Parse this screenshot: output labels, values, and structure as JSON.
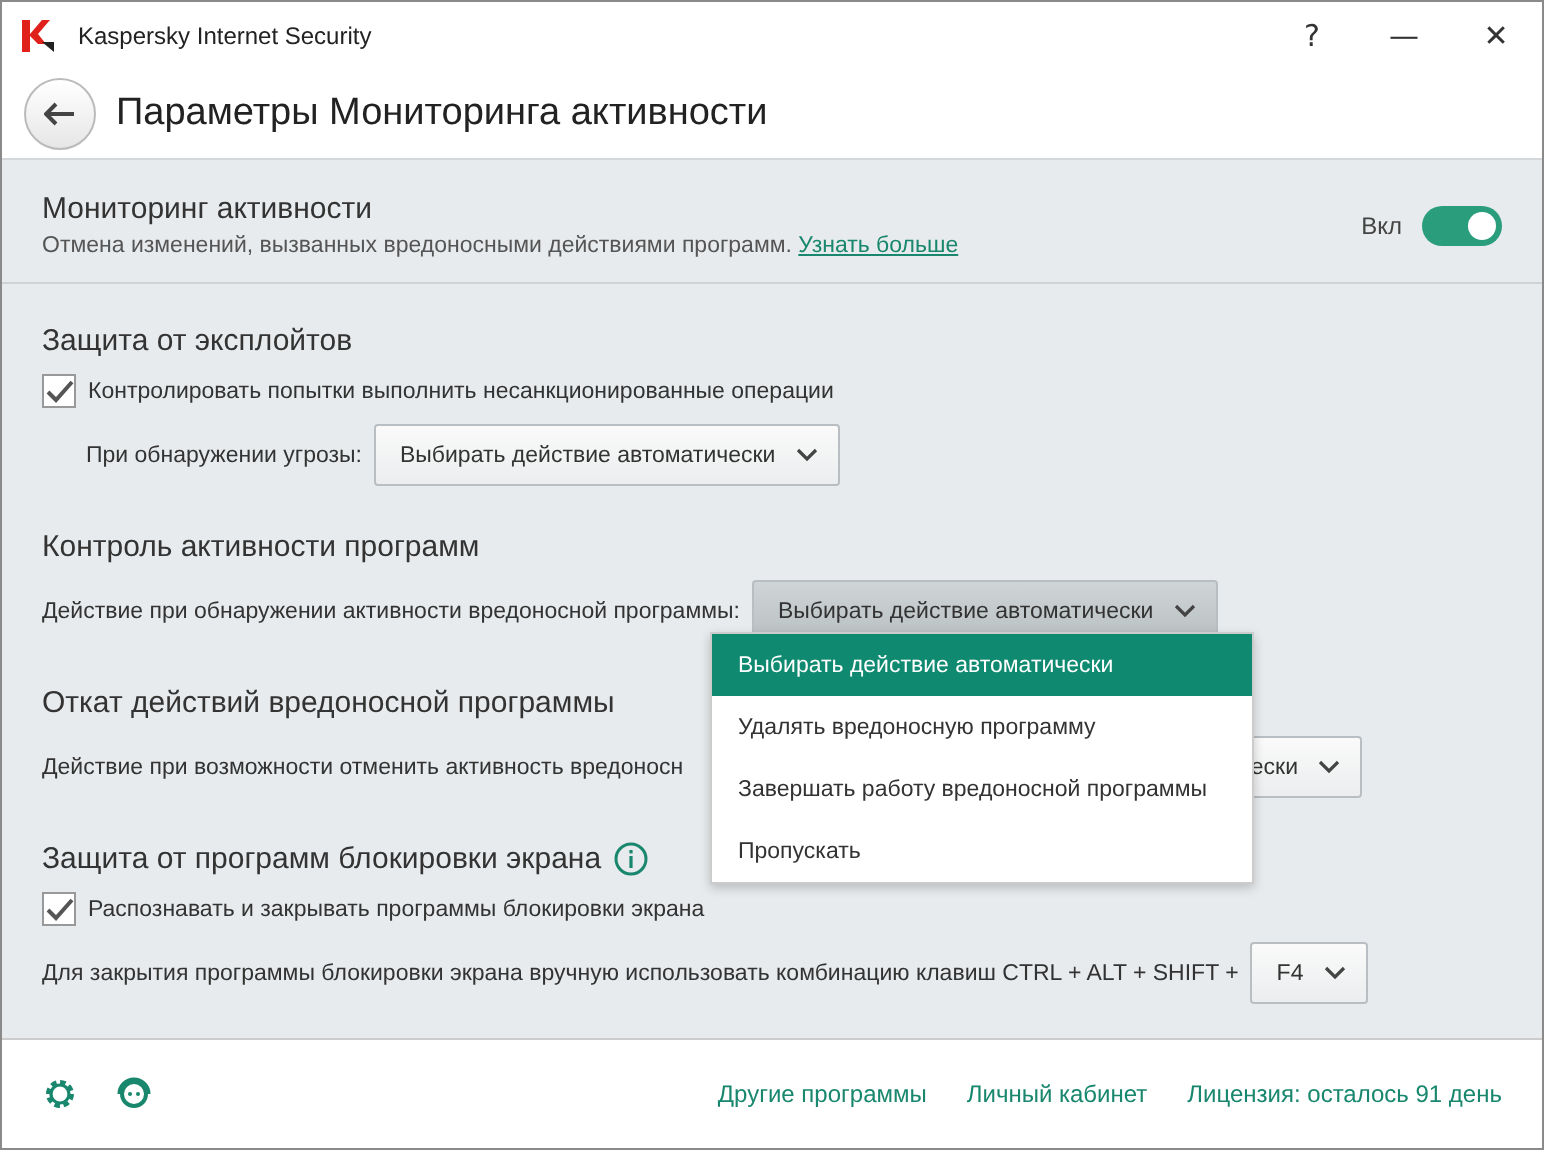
{
  "window": {
    "title": "Kaspersky Internet Security",
    "buttons": [
      "?",
      "—",
      "✕"
    ]
  },
  "header": {
    "title": "Параметры Мониторинга активности"
  },
  "monitoring": {
    "title": "Мониторинг активности",
    "description": "Отмена изменений, вызванных вредоносными действиями программ.",
    "link": "Узнать больше",
    "toggle_label": "Вкл",
    "on": true
  },
  "sections": [
    {
      "title": "Защита от эксплойтов",
      "info": false,
      "rows": [
        {
          "kind": "checkbox",
          "label": "Контролировать попытки выполнить несанкционированные операции",
          "checked": true
        },
        {
          "kind": "select",
          "label": "При обнаружении угрозы:",
          "value": "Выбирать действие автоматически",
          "indent": true,
          "open": false
        }
      ]
    },
    {
      "title": "Контроль активности программ",
      "info": false,
      "rows": [
        {
          "kind": "select",
          "label": "Действие при обнаружении активности вредоносной программы:",
          "value": "Выбирать действие автоматически",
          "indent": false,
          "open": true
        }
      ]
    },
    {
      "title": "Откат действий вредоносной программы",
      "info": false,
      "rows": [
        {
          "kind": "covered",
          "label": "Действие при возможности отменить активность вредоносн",
          "value": "ески"
        }
      ]
    },
    {
      "title": "Защита от программ блокировки экрана",
      "info": true,
      "rows": [
        {
          "kind": "checkbox",
          "label": "Распознавать и закрывать программы блокировки экрана",
          "checked": true
        },
        {
          "kind": "select",
          "label": "Для закрытия программы блокировки экрана вручную использовать комбинацию клавиш CTRL + ALT + SHIFT +",
          "value": "F4",
          "indent": false,
          "open": false
        }
      ]
    }
  ],
  "dropdown_menu": [
    {
      "label": "Выбирать действие автоматически",
      "selected": true
    },
    {
      "label": "Удалять вредоносную программу",
      "selected": false
    },
    {
      "label": "Завершать работу вредоносной программы",
      "selected": false
    },
    {
      "label": "Пропускать",
      "selected": false
    }
  ],
  "footer": {
    "links": [
      "Другие программы",
      "Личный кабинет",
      "Лицензия: осталось 91 день"
    ]
  }
}
